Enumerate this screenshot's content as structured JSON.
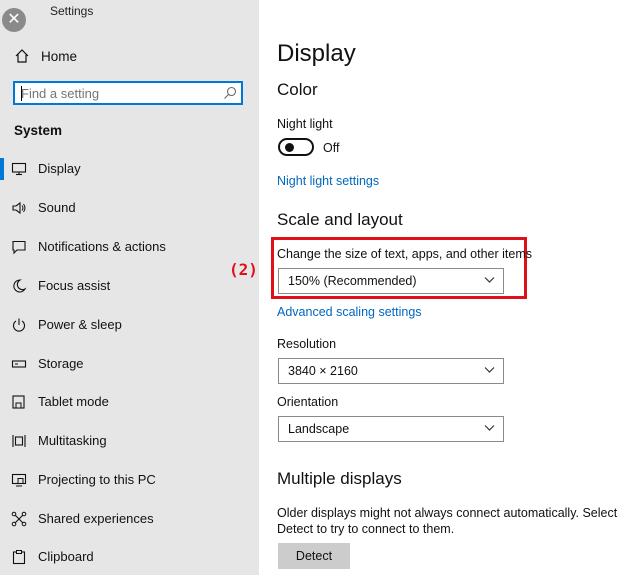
{
  "window": {
    "title": "Settings",
    "close_glyph": "✕"
  },
  "sidebar": {
    "home_label": "Home",
    "search_placeholder": "Find a setting",
    "section_label": "System",
    "items": [
      {
        "label": "Display",
        "icon": "monitor-icon",
        "selected": true
      },
      {
        "label": "Sound",
        "icon": "speaker-icon"
      },
      {
        "label": "Notifications & actions",
        "icon": "notification-icon"
      },
      {
        "label": "Focus assist",
        "icon": "moon-icon"
      },
      {
        "label": "Power & sleep",
        "icon": "power-icon"
      },
      {
        "label": "Storage",
        "icon": "storage-icon"
      },
      {
        "label": "Tablet mode",
        "icon": "tablet-icon"
      },
      {
        "label": "Multitasking",
        "icon": "multitasking-icon"
      },
      {
        "label": "Projecting to this PC",
        "icon": "projecting-icon"
      },
      {
        "label": "Shared experiences",
        "icon": "shared-experiences-icon"
      },
      {
        "label": "Clipboard",
        "icon": "clipboard-icon"
      }
    ]
  },
  "main": {
    "title": "Display",
    "color_heading": "Color",
    "night_light_label": "Night light",
    "night_light_state": "Off",
    "night_light_link": "Night light settings",
    "scale_heading": "Scale and layout",
    "scale_label": "Change the size of text, apps, and other items",
    "scale_value": "150% (Recommended)",
    "advanced_scaling_link": "Advanced scaling settings",
    "resolution_label": "Resolution",
    "resolution_value": "3840 × 2160",
    "orientation_label": "Orientation",
    "orientation_value": "Landscape",
    "multiple_heading": "Multiple displays",
    "multiple_text_line1": "Older displays might not always connect automatically. Select",
    "multiple_text_line2": "Detect to try to connect to them.",
    "detect_button": "Detect"
  },
  "annotation": {
    "callout": "(2)",
    "color": "#e0101b"
  },
  "colors": {
    "accent": "#0078d7",
    "link": "#0067c0",
    "sidebar_bg": "#e6e6e6"
  }
}
